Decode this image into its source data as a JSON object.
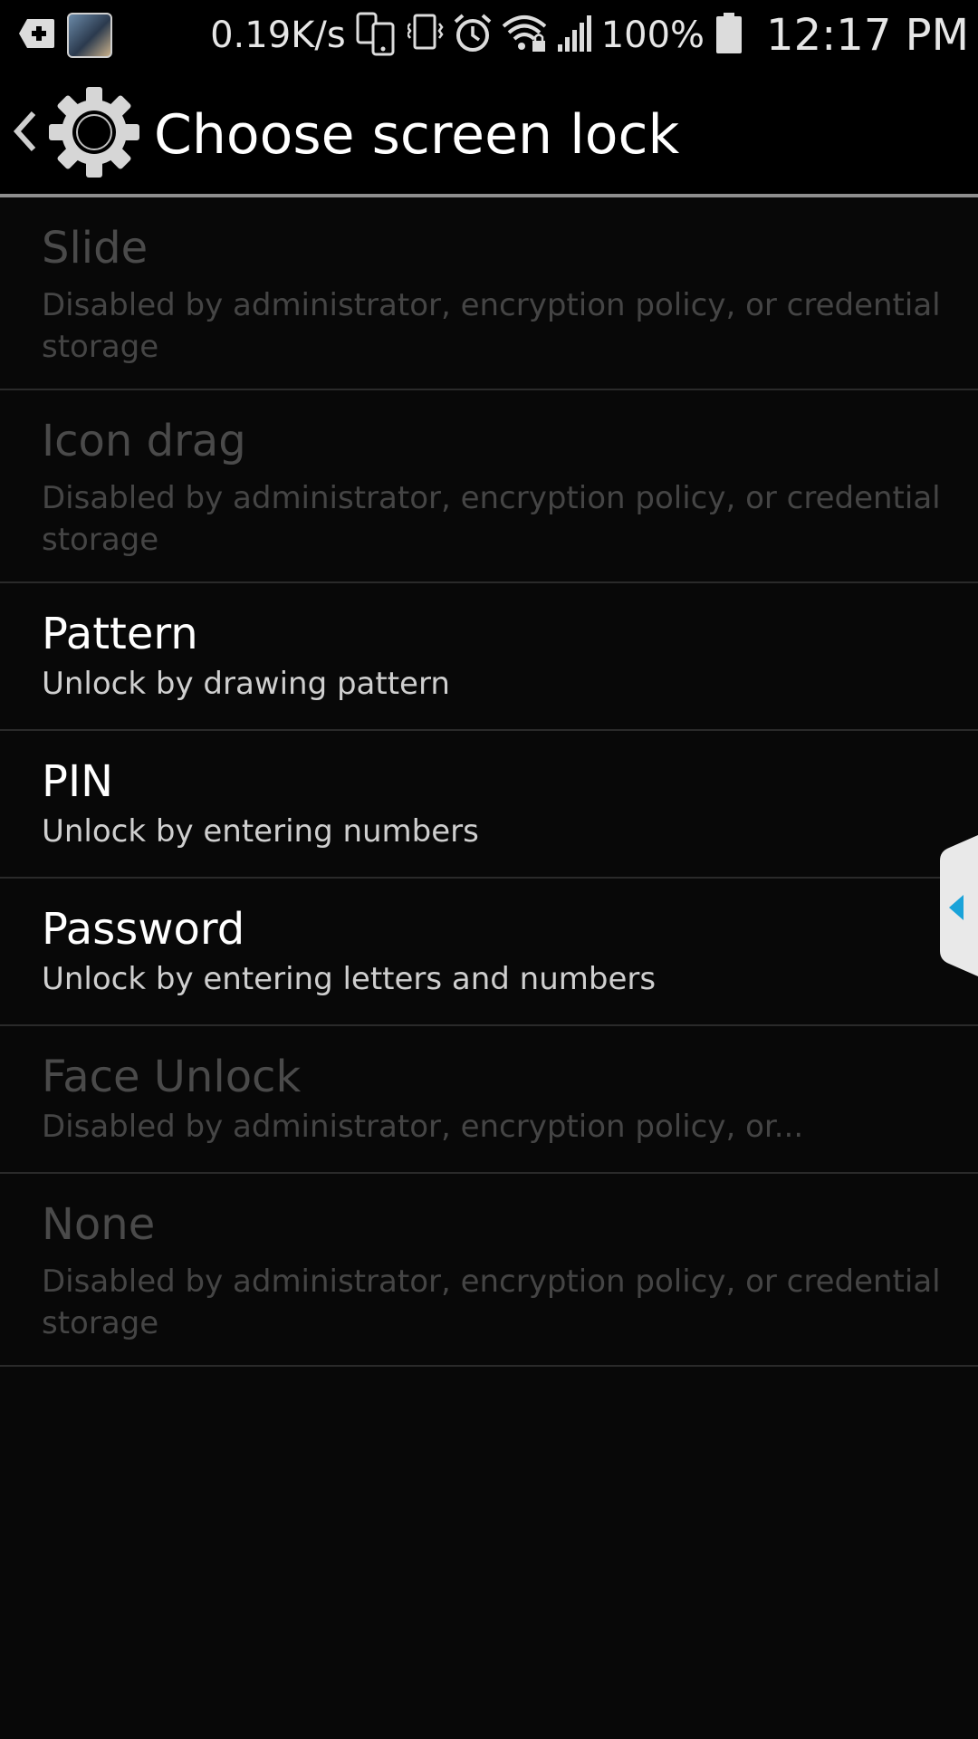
{
  "status_bar": {
    "speed": "0.19K/s",
    "battery": "100%",
    "time": "12:17 PM",
    "icons": [
      "add-box-icon",
      "avatar",
      "phone-transfer-icon",
      "vibrate-icon",
      "alarm-icon",
      "wifi-lock-icon",
      "signal-icon",
      "battery-icon"
    ]
  },
  "header": {
    "title": "Choose screen lock",
    "icons": [
      "back-chevron-icon",
      "gear-icon"
    ]
  },
  "options": [
    {
      "title": "Slide",
      "subtitle": "Disabled by administrator, encryption policy, or credential storage",
      "enabled": false
    },
    {
      "title": "Icon drag",
      "subtitle": "Disabled by administrator, encryption policy, or credential storage",
      "enabled": false
    },
    {
      "title": "Pattern",
      "subtitle": "Unlock by drawing pattern",
      "enabled": true
    },
    {
      "title": "PIN",
      "subtitle": "Unlock by entering numbers",
      "enabled": true
    },
    {
      "title": "Password",
      "subtitle": "Unlock by entering letters and numbers",
      "enabled": true
    },
    {
      "title": "Face Unlock",
      "subtitle": "Disabled by administrator, encryption policy, or...",
      "enabled": false
    },
    {
      "title": "None",
      "subtitle": "Disabled by administrator, encryption policy, or credential storage",
      "enabled": false
    }
  ],
  "colors": {
    "background": "#080808",
    "enabled_text": "#ffffff",
    "disabled_text": "#4a4a4a",
    "accent": "#1aa3d9"
  }
}
